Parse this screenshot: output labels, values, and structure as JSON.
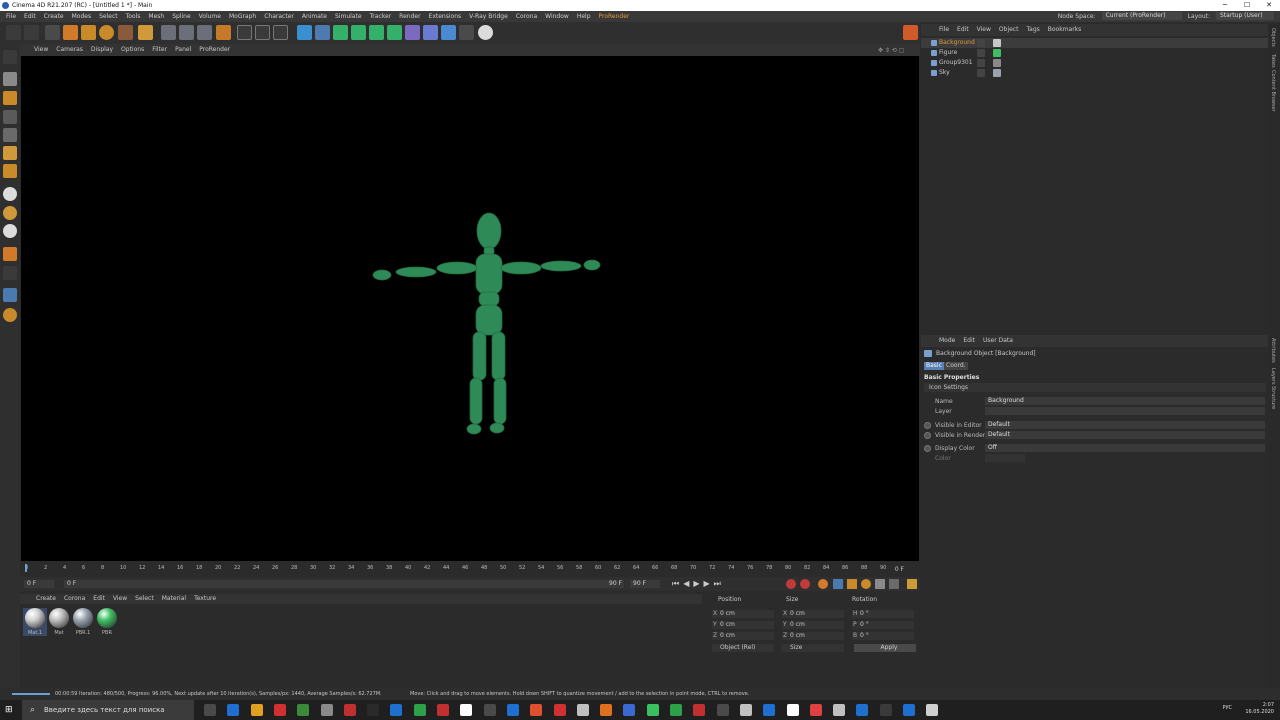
{
  "window": {
    "title": "Cinema 4D R21.207 (RC) - [Untitled 1 *] - Main",
    "minimize": "─",
    "maximize": "☐",
    "close": "✕"
  },
  "menubar": {
    "items": [
      "File",
      "Edit",
      "Create",
      "Modes",
      "Select",
      "Tools",
      "Mesh",
      "Spline",
      "Volume",
      "MoGraph",
      "Character",
      "Animate",
      "Simulate",
      "Tracker",
      "Render",
      "Extensions",
      "V-Ray Bridge",
      "Corona",
      "Window",
      "Help"
    ],
    "plugin": "ProRender",
    "node_space_label": "Node Space:",
    "node_space_value": "Current (ProRender)",
    "layout_label": "Layout:",
    "layout_value": "Startup (User)"
  },
  "viewport": {
    "menu": [
      "View",
      "Cameras",
      "Display",
      "Options",
      "Filter",
      "Panel",
      "ProRender"
    ],
    "figure_color": "#2e8b57",
    "background": "#000000"
  },
  "timeline": {
    "ticks": [
      "0",
      "2",
      "4",
      "6",
      "8",
      "10",
      "12",
      "14",
      "16",
      "18",
      "20",
      "22",
      "24",
      "26",
      "28",
      "30",
      "32",
      "34",
      "36",
      "38",
      "40",
      "42",
      "44",
      "46",
      "48",
      "50",
      "52",
      "54",
      "56",
      "58",
      "60",
      "62",
      "64",
      "66",
      "68",
      "70",
      "72",
      "74",
      "76",
      "78",
      "80",
      "82",
      "84",
      "86",
      "88",
      "90"
    ],
    "current_frame": "0 F",
    "start_field": "0 F",
    "preview_start": "0 F",
    "preview_end": "90 F",
    "end_field": "90 F"
  },
  "material_manager": {
    "menu": [
      "Create",
      "Corona",
      "Edit",
      "View",
      "Select",
      "Material",
      "Texture"
    ],
    "materials": [
      {
        "name": "Mat.1",
        "color": "#cfcfcf"
      },
      {
        "name": "Mat",
        "color": "#bdbdbd"
      },
      {
        "name": "PBR.1",
        "color": "#9aa4b0"
      },
      {
        "name": "PBR",
        "color": "#3fbf62"
      }
    ]
  },
  "coordinates": {
    "headers": [
      "Position",
      "Size",
      "Rotation"
    ],
    "rows": [
      {
        "axis": "X",
        "pos": "0 cm",
        "size_axis": "X",
        "size": "0 cm",
        "rot_axis": "H",
        "rot": "0 °"
      },
      {
        "axis": "Y",
        "pos": "0 cm",
        "size_axis": "Y",
        "size": "0 cm",
        "rot_axis": "P",
        "rot": "0 °"
      },
      {
        "axis": "Z",
        "pos": "0 cm",
        "size_axis": "Z",
        "size": "0 cm",
        "rot_axis": "B",
        "rot": "0 °"
      }
    ],
    "mode": "Object (Rel)",
    "size_mode": "Size",
    "apply": "Apply"
  },
  "object_manager": {
    "menu": [
      "File",
      "Edit",
      "View",
      "Object",
      "Tags",
      "Bookmarks"
    ],
    "objects": [
      {
        "name": "Background",
        "selected": true,
        "icon_color": "#7aa0d0"
      },
      {
        "name": "Figure",
        "selected": false,
        "icon_color": "#7aa0d0"
      },
      {
        "name": "Group9301",
        "selected": false,
        "icon_color": "#7aa0d0"
      },
      {
        "name": "Sky",
        "selected": false,
        "icon_color": "#7aa0d0"
      }
    ]
  },
  "attributes": {
    "menu": [
      "Mode",
      "Edit",
      "User Data"
    ],
    "object_title": "Background Object [Background]",
    "tabs": [
      "Basic",
      "Coord."
    ],
    "section": "Basic Properties",
    "subsection": "Icon Settings",
    "props": [
      {
        "label": "Name",
        "value": "Background"
      },
      {
        "label": "Layer",
        "value": ""
      },
      {
        "label": "Visible in Editor",
        "value": "Default"
      },
      {
        "label": "Visible in Renderer",
        "value": "Default"
      },
      {
        "label": "Display Color",
        "value": "Off"
      },
      {
        "label": "Color",
        "value": ""
      }
    ]
  },
  "vertical_tabs": [
    "Objects",
    "Takes",
    "Content Browser",
    "Attributes",
    "Layers",
    "Structure"
  ],
  "status": {
    "progress_text": "00:00:59 Iteration: 480/500, Progress: 96.00%, Next update after 10 iteration(s), Samples/px: 1440, Average Samples/s: 62.727M.",
    "hint": "Move: Click and drag to move elements. Hold down SHIFT to quantize movement / add to the selection in point mode, CTRL to remove.",
    "progress_fraction": 0.96
  },
  "taskbar": {
    "search_placeholder": "Введите здесь текст для поиска",
    "language": "РУС",
    "time": "2:07",
    "date": "16.05.2020"
  }
}
